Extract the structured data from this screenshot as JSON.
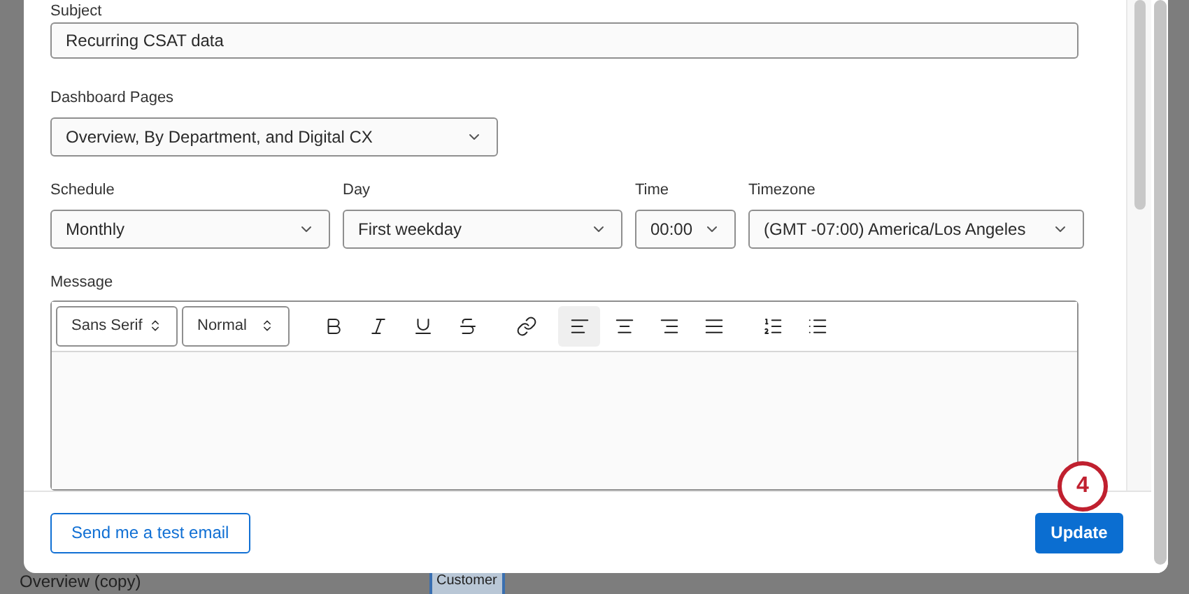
{
  "background": {
    "list_item": "Overview (copy)",
    "tag": "Customer"
  },
  "dialog": {
    "subject": {
      "label": "Subject",
      "value": "Recurring CSAT data"
    },
    "dashboard_pages": {
      "label": "Dashboard Pages",
      "value": "Overview, By Department, and Digital CX"
    },
    "schedule_fields": [
      {
        "label": "Schedule",
        "value": "Monthly"
      },
      {
        "label": "Day",
        "value": "First weekday"
      },
      {
        "label": "Time",
        "value": "00:00"
      },
      {
        "label": "Timezone",
        "value": "(GMT -07:00) America/Los Angeles"
      }
    ],
    "message": {
      "label": "Message",
      "font": "Sans Serif",
      "size": "Normal",
      "toolbar": [
        {
          "kind": "bold",
          "selected": false
        },
        {
          "kind": "italic",
          "selected": false
        },
        {
          "kind": "underline",
          "selected": false
        },
        {
          "kind": "strike",
          "selected": false
        },
        {
          "kind": "link",
          "selected": false
        },
        {
          "kind": "align-left",
          "selected": true
        },
        {
          "kind": "align-center",
          "selected": false
        },
        {
          "kind": "align-right",
          "selected": false
        },
        {
          "kind": "justify",
          "selected": false
        },
        {
          "kind": "ordered-list",
          "selected": false
        },
        {
          "kind": "bullet-list",
          "selected": false
        }
      ]
    },
    "test_button": "Send me a test email",
    "update_button": "Update",
    "step_marker": "4"
  }
}
